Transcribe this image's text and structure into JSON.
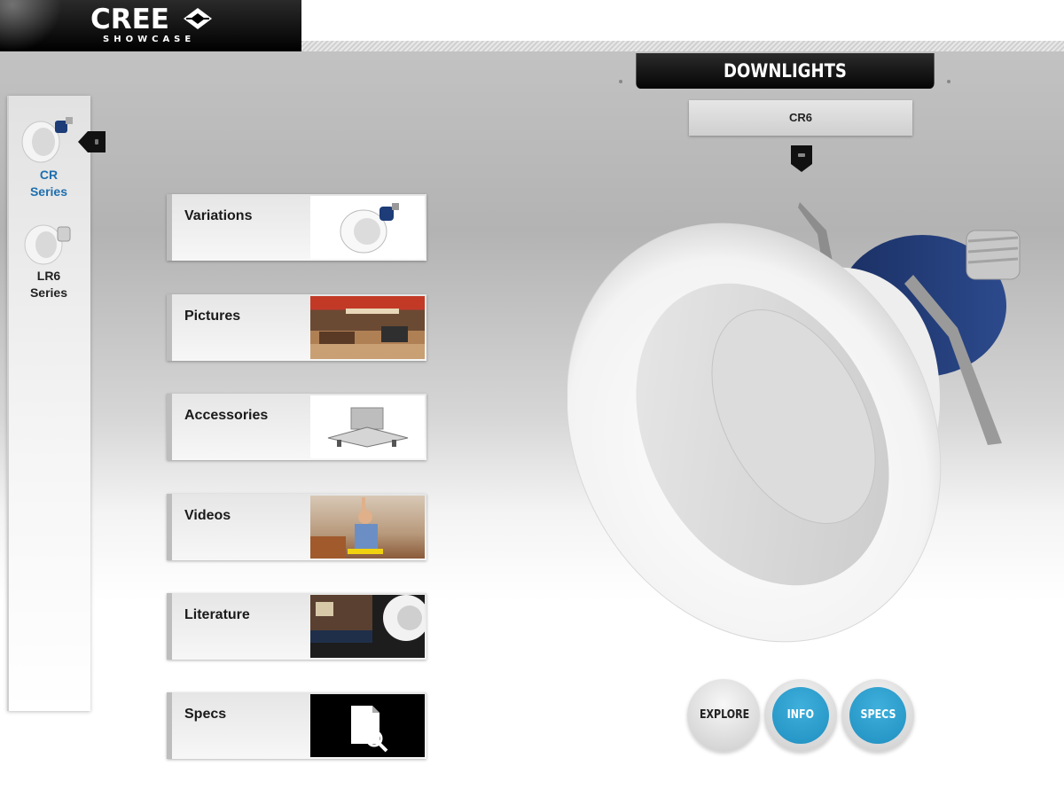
{
  "brand": {
    "name": "CREE",
    "subtitle": "SHOWCASE"
  },
  "series_sidebar": {
    "items": [
      {
        "label": "CR\nSeries",
        "line1": "CR",
        "line2": "Series",
        "active": true
      },
      {
        "label": "LR6\nSeries",
        "line1": "LR6",
        "line2": "Series",
        "active": false
      }
    ]
  },
  "categories": [
    {
      "label": "Variations",
      "thumb": "downlight-variation-icon"
    },
    {
      "label": "Pictures",
      "thumb": "interior-photo"
    },
    {
      "label": "Accessories",
      "thumb": "mounting-frame-photo"
    },
    {
      "label": "Videos",
      "thumb": "install-video-photo"
    },
    {
      "label": "Literature",
      "thumb": "brochure-photo"
    },
    {
      "label": "Specs",
      "thumb": "document-search-icon"
    }
  ],
  "product": {
    "category": "DOWNLIGHTS",
    "model": "CR6"
  },
  "actions": [
    {
      "label": "EXPLORE",
      "style": "plain"
    },
    {
      "label": "INFO",
      "style": "blue"
    },
    {
      "label": "SPECS",
      "style": "blue"
    }
  ],
  "colors": {
    "accent_blue": "#1f8fc0",
    "active_series": "#1e6fae",
    "header_black": "#050505"
  }
}
